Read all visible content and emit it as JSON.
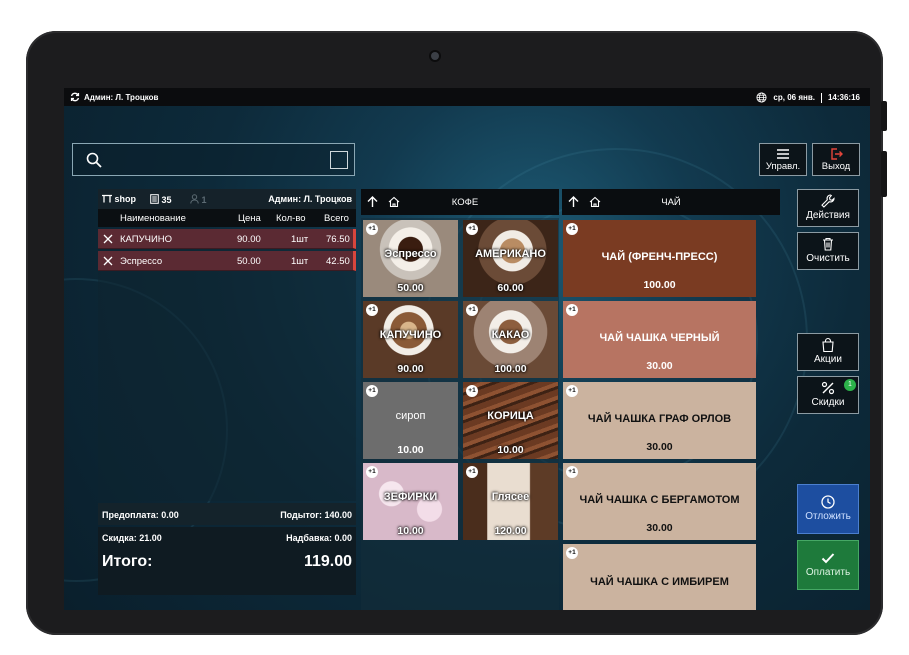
{
  "status": {
    "user": "Админ: Л. Троцков",
    "date": "ср, 06 янв.",
    "time": "14:36:16"
  },
  "toolbar": {
    "manage_label": "Управл.",
    "exit_label": "Выход"
  },
  "order": {
    "shop": "shop",
    "receipt_no": "35",
    "guests": "1",
    "cashier": "Админ: Л. Троцков",
    "columns": {
      "name": "Наименование",
      "price": "Цена",
      "qty": "Кол-во",
      "total": "Всего"
    },
    "items": [
      {
        "name": "КАПУЧИНО",
        "price": "90.00",
        "qty": "1шт",
        "total": "76.50"
      },
      {
        "name": "Эспрессо",
        "price": "50.00",
        "qty": "1шт",
        "total": "42.50"
      }
    ],
    "prepay": "Предоплата: 0.00",
    "subtotal": "Подытог: 140.00",
    "discount": "Скидка: 21.00",
    "surcharge": "Надбавка: 0.00",
    "total_label": "Итого:",
    "total_value": "119.00"
  },
  "coffee": {
    "title": "КОФЕ",
    "tiles": [
      {
        "name": "Эспрессо",
        "price": "50.00",
        "plus": "+1"
      },
      {
        "name": "АМЕРИКАНО",
        "price": "60.00",
        "plus": "+1"
      },
      {
        "name": "КАПУЧИНО",
        "price": "90.00",
        "plus": "+1"
      },
      {
        "name": "КАКАО",
        "price": "100.00",
        "plus": "+1"
      },
      {
        "name": "сироп",
        "price": "10.00",
        "plus": "+1"
      },
      {
        "name": "КОРИЦА",
        "price": "10.00",
        "plus": "+1"
      },
      {
        "name": "ЗЕФИРКИ",
        "price": "10.00",
        "plus": "+1"
      },
      {
        "name": "Глясее",
        "price": "120.00",
        "plus": "+1"
      }
    ]
  },
  "tea": {
    "title": "ЧАЙ",
    "tiles": [
      {
        "name": "ЧАЙ (ФРЕНЧ-ПРЕСС)",
        "price": "100.00",
        "plus": "+1"
      },
      {
        "name": "ЧАЙ ЧАШКА ЧЕРНЫЙ",
        "price": "30.00",
        "plus": "+1"
      },
      {
        "name": "ЧАЙ ЧАШКА ГРАФ ОРЛОВ",
        "price": "30.00",
        "plus": "+1"
      },
      {
        "name": "ЧАЙ ЧАШКА С БЕРГАМОТОМ",
        "price": "30.00",
        "plus": "+1"
      },
      {
        "name": "ЧАЙ ЧАШКА С ИМБИРЕМ",
        "price": "",
        "plus": "+1"
      }
    ]
  },
  "actions": {
    "actions_label": "Действия",
    "clear_label": "Очистить",
    "promos_label": "Акции",
    "discounts_label": "Скидки",
    "discounts_badge": "1",
    "postpone_label": "Отложить",
    "pay_label": "Оплатить"
  },
  "colors": {
    "tea1": "#7a3b22",
    "tea2": "#b77462",
    "tea3": "#cbb39f",
    "postpone": "#1d4ea0",
    "pay": "#1e7a3b",
    "order_row": "#5b2a33"
  }
}
